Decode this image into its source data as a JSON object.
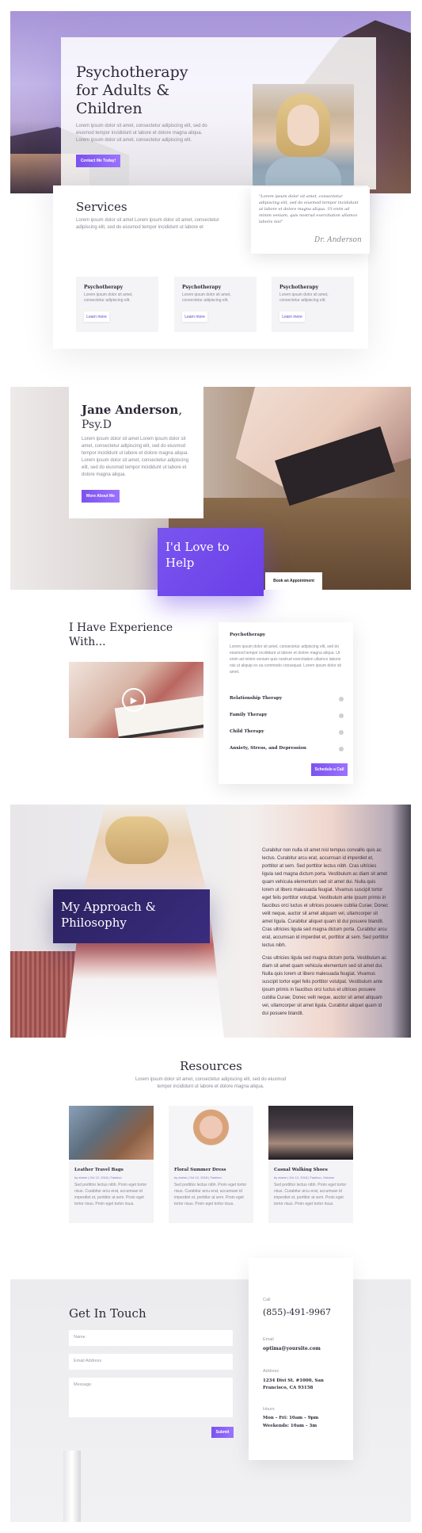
{
  "hero": {
    "title": "Psychotherapy for Adults & Children",
    "text": "Lorem ipsum dolor sit amet, consectetur adipiscing elit, sed do eiusmod tempor incididunt ut labore et dolore magna aliqua. Lorem ipsum dolor sit amet, consectetur adipiscing elit.",
    "cta": "Contact Me Today!"
  },
  "services": {
    "title": "Services",
    "text": "Lorem ipsum dolor sit amet Lorem ipsum dolor sit amet, consectetur adipiscing elit, sed do eiusmod tempor incididunt ut labore et",
    "quote": "\"Lorem ipsum dolor sit amet, consectetur adipiscing elit, sed do eiusmod tempor incididunt ut labore et dolore magna aliqua. Ut enim ad minim veniam, quis nostrud exercitation ullamco laboris nisi\"",
    "signature": "Dr. Anderson",
    "cards": [
      {
        "title": "Psychotherapy",
        "text": "Lorem ipsum dolor sit amet, consectetur adipiscing elit.",
        "button": "Learn more"
      },
      {
        "title": "Psychotherapy",
        "text": "Lorem ipsum dolor sit amet, consectetur adipiscing elit.",
        "button": "Learn more"
      },
      {
        "title": "Psychotherapy",
        "text": "Lorem ipsum dolor sit amet, consectetur adipiscing elit.",
        "button": "Learn more"
      }
    ]
  },
  "about": {
    "name": "Jane Anderson",
    "suffix": ",",
    "credential": "Psy.D",
    "text": "Lorem ipsum dolor sit amet Lorem ipsum dolor sit amet, consectetur adipiscing elit, sed do eiusmod tempor incididunt ut labore et dolore magna aliqua. Lorem ipsum dolor sit amet, consectetur adipiscing elit, sed do eiusmod tempor incididunt ut labore et dolore magna aliqua.",
    "button": "More About Me",
    "love": "I'd Love to Help",
    "appointment": "Book an Appointment"
  },
  "experience": {
    "title": "I Have Experience With...",
    "open_item": "Psychotherapy",
    "open_text": "Lorem ipsum dolor sit amet, consectetur adipiscing elit, sed do eiusmod tempor incididunt ut labore et dolore magna aliqua. Ut enim ad minim veniam quis nostrud exercitation ullamco laboris nisi ut aliquip ex ea commodo consequat. Lorem ipsum dolor sit amet.",
    "items": [
      "Relationship Therapy",
      "Family Therapy",
      "Child Therapy",
      "Anxiety, Stress, and Depression"
    ],
    "button": "Schedule a Call"
  },
  "approach": {
    "title": "My Approach & Philosophy",
    "p1": "Curabitur non nulla sit amet nisl tempus convallis quis ac lectus. Curabitur arcu erat, accumsan id imperdiet et, porttitor at sem. Sed porttitor lectus nibh. Cras ultricies ligula sed magna dictum porta. Vestibulum ac diam sit amet quam vehicula elementum sed sit amet dui. Nulla quis lorem ut libero malesuada feugiat. Vivamus suscipit tortor eget felis porttitor volutpat. Vestibulum ante ipsum primis in faucibus orci luctus et ultrices posuere cubilia Curae; Donec velit neque, auctor sit amet aliquam vel, ullamcorper sit amet ligula. Curabitur aliquet quam id dui posuere blandit. Cras ultricies ligula sed magna dictum porta. Curabitur arcu erat, accumsan id imperdiet et, porttitor at sem. Sed porttitor lectus nibh.",
    "p2": "Cras ultricies ligula sed magna dictum porta. Vestibulum ac diam sit amet quam vehicula elementum sed sit amet dui. Nulla quis lorem ut libero malesuada feugiat. Vivamus suscipit tortor eget felis porttitor volutpat. Vestibulum ante ipsum primis in faucibus orci luctus et ultrices posuere cubilia Curae; Donec velit neque, auctor sit amet aliquam vel, ullamcorper sit amet ligula. Curabitur aliquet quam id dui posuere blandit."
  },
  "resources": {
    "title": "Resources",
    "text": "Lorem ipsum dolor sit amet, consectetur adipiscing elit, sed do eiusmod tempor incididunt ut labore et dolore magna aliqua.",
    "posts": [
      {
        "title": "Leather Travel Bags",
        "meta": "by elaine | Oct 12, 2018 | Fashion",
        "text": "Sed porttitor lectus nibh. Proin eget tortor risus. Curabitur arcu erat, accumsan id imperdiet et, porttitor at sem. Proin eget tortor risus. Proin eget tortor risus."
      },
      {
        "title": "Floral Summer Dress",
        "meta": "by elaine | Oct 12, 2018 | Fashion",
        "text": "Sed porttitor lectus nibh. Proin eget tortor risus. Curabitur arcu erat, accumsan id imperdiet et, porttitor at sem. Proin eget tortor risus. Proin eget tortor risus."
      },
      {
        "title": "Casual Walking Shoes",
        "meta": "by elaine | Oct 12, 2018 | Fashion, Outdoor",
        "text": "Sed porttitor lectus nibh. Proin eget tortor risus. Curabitur arcu erat, accumsan id imperdiet et, porttitor at sem. Proin eget tortor risus. Proin eget tortor risus."
      }
    ]
  },
  "contact": {
    "title": "Get In Touch",
    "name_ph": "Name",
    "email_ph": "Email Address",
    "message_ph": "Message",
    "submit": "Submit",
    "call_label": "Call",
    "phone": "(855)-491-9967",
    "email_label": "Email",
    "email": "optima@yoursite.com",
    "address_label": "Address",
    "address": "1234 Divi St. #1000, San Francisco, CA 93158",
    "hours_label": "Hours",
    "hours1": "Mon – Fri: 10am – 9pm",
    "hours2": "Weekends: 10am – 3m"
  },
  "colors": {
    "accent": "#7b52ee",
    "dark_panel": "#2b2260"
  }
}
